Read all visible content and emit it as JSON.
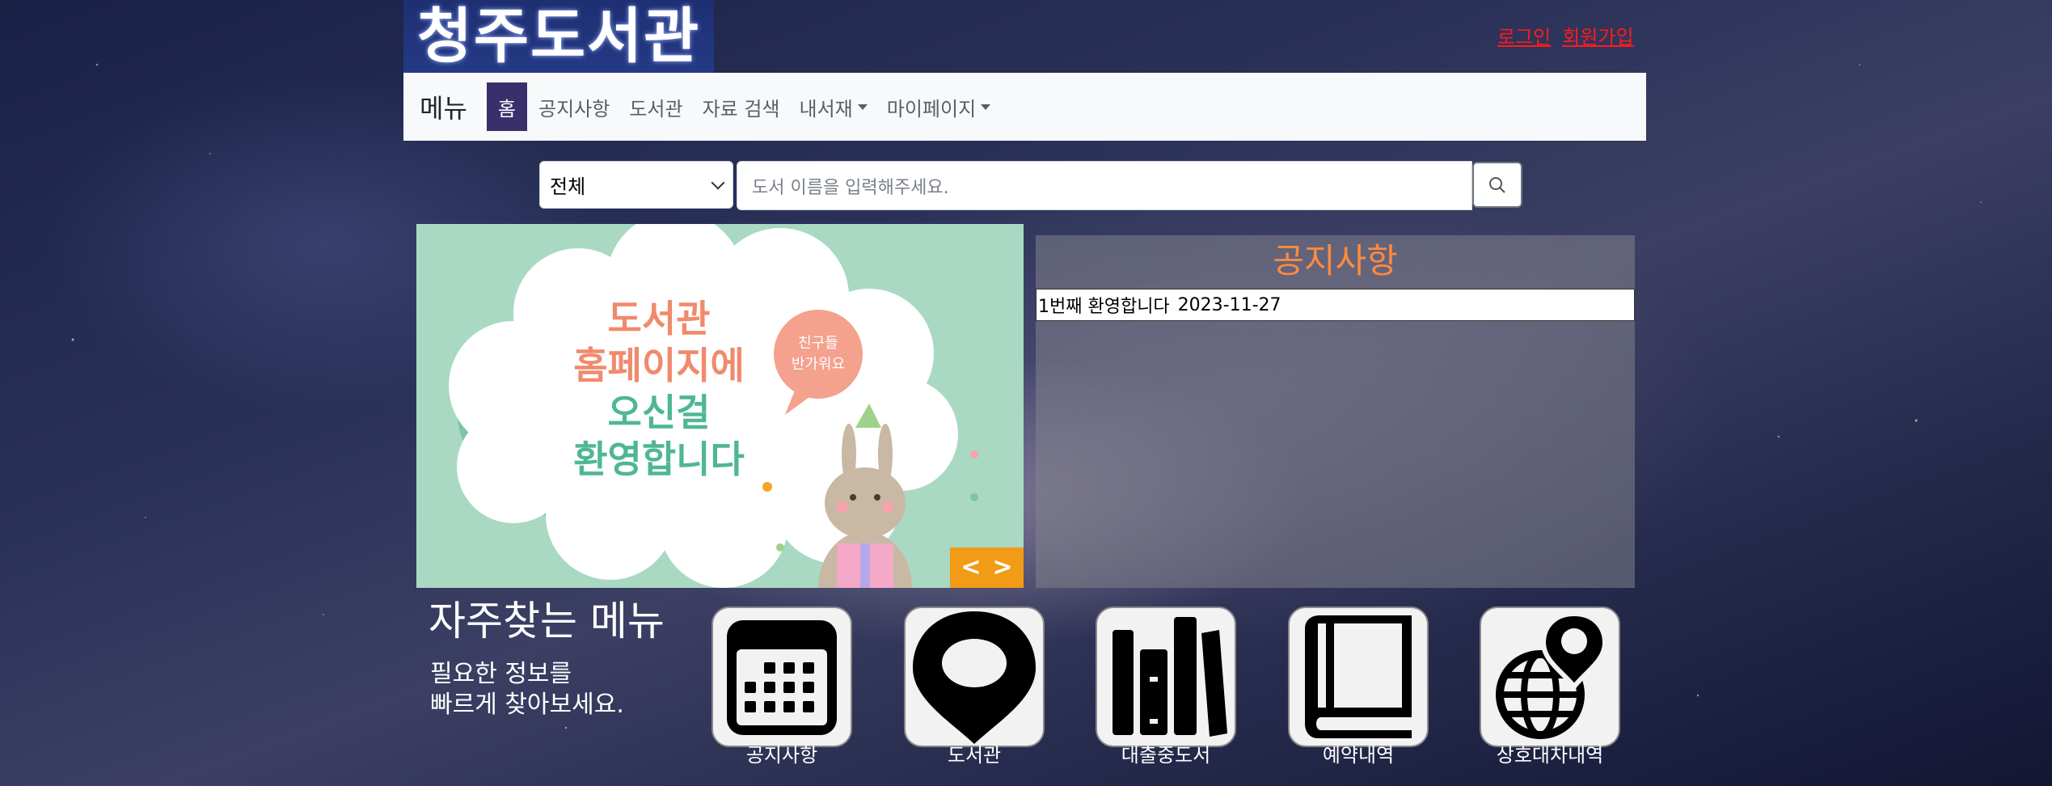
{
  "header": {
    "logo_text": "청주도서관",
    "login_label": "로그인",
    "signup_label": "회원가입"
  },
  "nav": {
    "brand": "메뉴",
    "items": [
      {
        "label": "홈",
        "active": true
      },
      {
        "label": "공지사항"
      },
      {
        "label": "도서관"
      },
      {
        "label": "자료 검색"
      },
      {
        "label": "내서재",
        "dropdown": true
      },
      {
        "label": "마이페이지",
        "dropdown": true
      }
    ]
  },
  "search": {
    "category_selected": "전체",
    "placeholder": "도서 이름을 입력해주세요."
  },
  "carousel": {
    "slide_text": [
      "도서관",
      "홈페이지에",
      "오신걸",
      "환영합니다"
    ],
    "bubble_text": [
      "친구들",
      "반가워요"
    ],
    "prev_label": "<",
    "next_label": ">"
  },
  "notice": {
    "title": "공지사항",
    "items": [
      {
        "title": "1번째 환영합니다",
        "date": "2023-11-27"
      }
    ]
  },
  "quick_menu": {
    "title": "자주찾는 메뉴",
    "subtitle_line1": "필요한 정보를",
    "subtitle_line2": "빠르게 찾아보세요.",
    "items": [
      {
        "label": "공지사항",
        "icon": "calendar-icon"
      },
      {
        "label": "도서관",
        "icon": "map-pin-icon"
      },
      {
        "label": "대출중도서",
        "icon": "books-icon"
      },
      {
        "label": "예약내역",
        "icon": "book-icon"
      },
      {
        "label": "상호대차내역",
        "icon": "globe-pin-icon"
      }
    ]
  },
  "colors": {
    "nav_active": "#3a2f6b",
    "auth_link": "#ff1a1a",
    "notice_title": "#ff8a3d",
    "carousel_bg": "#a9d9c3",
    "carousel_ctrl": "#f29b16"
  }
}
